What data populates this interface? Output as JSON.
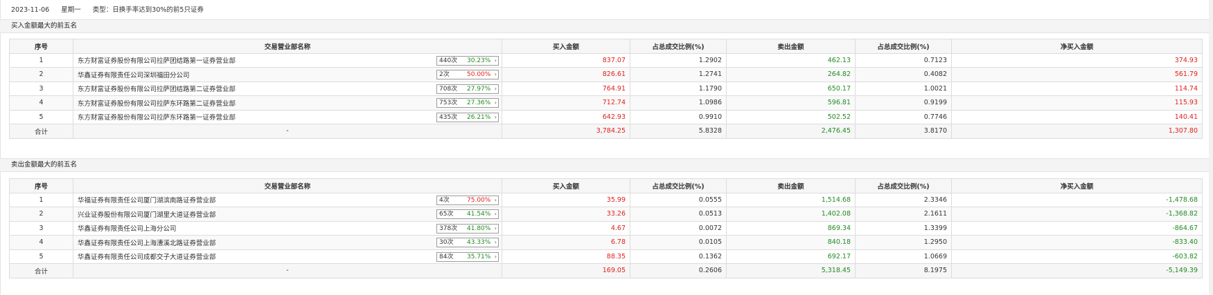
{
  "info": {
    "date": "2023-11-06",
    "weekday": "星期一",
    "type_text": "类型：日换手率达到30%的前5只证券"
  },
  "buy_section": {
    "title": "买入金额最大的前五名",
    "headers": [
      "序号",
      "交易营业部名称",
      "买入金额",
      "占总成交比例(%)",
      "卖出金额",
      "占总成交比例(%)",
      "净买入金额"
    ],
    "rows": [
      {
        "idx": "1",
        "name": "东方财富证券股份有限公司拉萨团结路第一证券营业部",
        "times": "440次",
        "rate": "30.23%",
        "rate_color": "green",
        "buy": "837.07",
        "buy_pct": "1.2902",
        "sell": "462.13",
        "sell_pct": "0.7123",
        "net": "374.93",
        "net_color": "red"
      },
      {
        "idx": "2",
        "name": "华鑫证券有限责任公司深圳福田分公司",
        "times": "2次",
        "rate": "50.00%",
        "rate_color": "red",
        "buy": "826.61",
        "buy_pct": "1.2741",
        "sell": "264.82",
        "sell_pct": "0.4082",
        "net": "561.79",
        "net_color": "red"
      },
      {
        "idx": "3",
        "name": "东方财富证券股份有限公司拉萨团结路第二证券营业部",
        "times": "708次",
        "rate": "27.97%",
        "rate_color": "green",
        "buy": "764.91",
        "buy_pct": "1.1790",
        "sell": "650.17",
        "sell_pct": "1.0021",
        "net": "114.74",
        "net_color": "red"
      },
      {
        "idx": "4",
        "name": "东方财富证券股份有限公司拉萨东环路第二证券营业部",
        "times": "753次",
        "rate": "27.36%",
        "rate_color": "green",
        "buy": "712.74",
        "buy_pct": "1.0986",
        "sell": "596.81",
        "sell_pct": "0.9199",
        "net": "115.93",
        "net_color": "red"
      },
      {
        "idx": "5",
        "name": "东方财富证券股份有限公司拉萨东环路第一证券营业部",
        "times": "435次",
        "rate": "26.21%",
        "rate_color": "green",
        "buy": "642.93",
        "buy_pct": "0.9910",
        "sell": "502.52",
        "sell_pct": "0.7746",
        "net": "140.41",
        "net_color": "red"
      }
    ],
    "total": {
      "label": "合计",
      "name": "-",
      "buy": "3,784.25",
      "buy_pct": "5.8328",
      "sell": "2,476.45",
      "sell_pct": "3.8170",
      "net": "1,307.80",
      "net_color": "red"
    }
  },
  "sell_section": {
    "title": "卖出金额最大的前五名",
    "headers": [
      "序号",
      "交易营业部名称",
      "买入金额",
      "占总成交比例(%)",
      "卖出金额",
      "占总成交比例(%)",
      "净买入金额"
    ],
    "rows": [
      {
        "idx": "1",
        "name": "华福证券有限责任公司厦门湖滨南路证券营业部",
        "times": "4次",
        "rate": "75.00%",
        "rate_color": "red",
        "buy": "35.99",
        "buy_pct": "0.0555",
        "sell": "1,514.68",
        "sell_pct": "2.3346",
        "net": "-1,478.68",
        "net_color": "green"
      },
      {
        "idx": "2",
        "name": "兴业证券股份有限公司厦门湖里大道证券营业部",
        "times": "65次",
        "rate": "41.54%",
        "rate_color": "green",
        "buy": "33.26",
        "buy_pct": "0.0513",
        "sell": "1,402.08",
        "sell_pct": "2.1611",
        "net": "-1,368.82",
        "net_color": "green"
      },
      {
        "idx": "3",
        "name": "华鑫证券有限责任公司上海分公司",
        "times": "378次",
        "rate": "41.80%",
        "rate_color": "green",
        "buy": "4.67",
        "buy_pct": "0.0072",
        "sell": "869.34",
        "sell_pct": "1.3399",
        "net": "-864.67",
        "net_color": "green"
      },
      {
        "idx": "4",
        "name": "华鑫证券有限责任公司上海漕溪北路证券营业部",
        "times": "30次",
        "rate": "43.33%",
        "rate_color": "green",
        "buy": "6.78",
        "buy_pct": "0.0105",
        "sell": "840.18",
        "sell_pct": "1.2950",
        "net": "-833.40",
        "net_color": "green"
      },
      {
        "idx": "5",
        "name": "华鑫证券有限责任公司成都交子大道证券营业部",
        "times": "84次",
        "rate": "35.71%",
        "rate_color": "green",
        "buy": "88.35",
        "buy_pct": "0.1362",
        "sell": "692.17",
        "sell_pct": "1.0669",
        "net": "-603.82",
        "net_color": "green"
      }
    ],
    "total": {
      "label": "合计",
      "name": "-",
      "buy": "169.05",
      "buy_pct": "0.2606",
      "sell": "5,318.45",
      "sell_pct": "8.1975",
      "net": "-5,149.39",
      "net_color": "green"
    }
  },
  "colors": {
    "up": "#e0201b",
    "down": "#1f8b1f",
    "header_bg": "#f6f6f6",
    "border": "#dcdcdc"
  },
  "icons": {
    "stat_arrow": "chevron-right-icon"
  }
}
